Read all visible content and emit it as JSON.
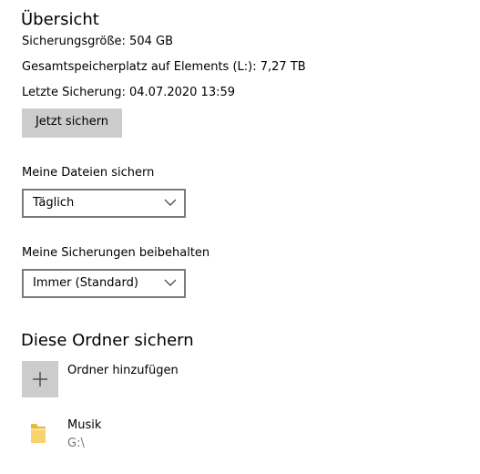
{
  "overview": {
    "title": "Übersicht",
    "backup_size": "Sicherungsgröße: 504 GB",
    "total_storage": "Gesamtspeicherplatz auf Elements (L:): 7,27 TB",
    "last_backup": "Letzte Sicherung: 04.07.2020 13:59",
    "backup_now_label": "Jetzt sichern"
  },
  "backup_files": {
    "label": "Meine Dateien sichern",
    "selected": "Täglich"
  },
  "keep_backups": {
    "label": "Meine Sicherungen beibehalten",
    "selected": "Immer (Standard)"
  },
  "folders": {
    "title": "Diese Ordner sichern",
    "add_label": "Ordner hinzufügen",
    "items": [
      {
        "name": "Musik",
        "path": "G:\\",
        "icon": "folder-icon"
      }
    ]
  },
  "colors": {
    "button_bg": "#cccccc",
    "select_border": "#7a7a7a",
    "path_text": "#767676",
    "folder_yellow": "#f7d46b"
  }
}
